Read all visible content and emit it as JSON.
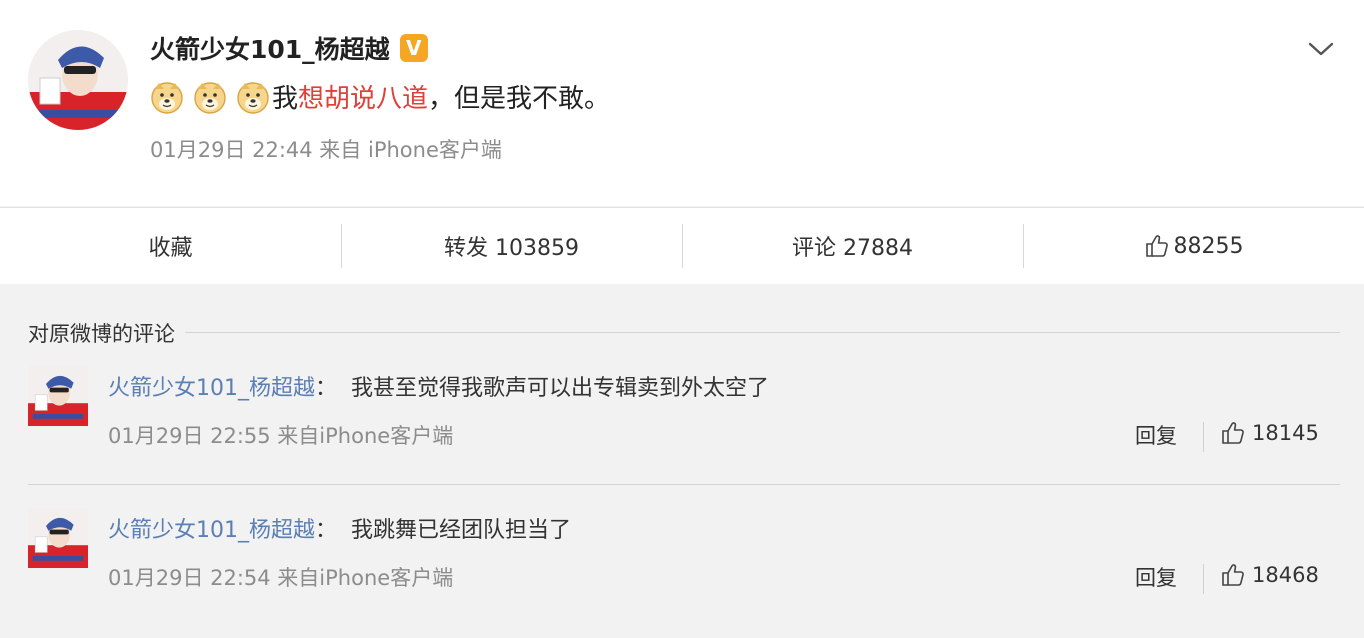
{
  "post": {
    "author": "火箭少女101_杨超越",
    "verified_badge": "V",
    "text_before": "我",
    "text_highlight": "想胡说八道",
    "text_after": "，但是我不敢。",
    "emoji_name": "doge-emoji",
    "emoji_count": 3,
    "meta": "01月29日 22:44 来自 iPhone客户端"
  },
  "actions": {
    "favorite": "收藏",
    "repost": "转发 103859",
    "comment": "评论 27884",
    "like": "88255"
  },
  "comments_section": {
    "title": "对原微博的评论",
    "items": [
      {
        "author": "火箭少女101_杨超越",
        "separator": "：",
        "text": "我甚至觉得我歌声可以出专辑卖到外太空了",
        "meta": "01月29日 22:55 来自iPhone客户端",
        "reply": "回复",
        "likes": "18145"
      },
      {
        "author": "火箭少女101_杨超越",
        "separator": "：",
        "text": "我跳舞已经团队担当了",
        "meta": "01月29日 22:54 来自iPhone客户端",
        "reply": "回复",
        "likes": "18468"
      }
    ]
  },
  "colors": {
    "link_name": "#5b7fb5",
    "highlight": "#e0403a",
    "verified": "#f5a623",
    "background": "#f2f2f2"
  }
}
